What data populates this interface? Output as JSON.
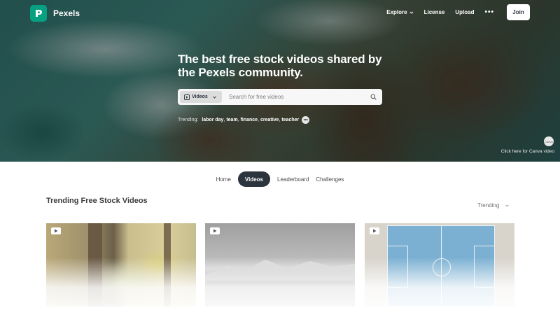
{
  "brand": {
    "name": "Pexels",
    "accent": "#07a081",
    "logo_icon": "pexels-logo-icon"
  },
  "nav": {
    "explore": "Explore",
    "license": "License",
    "upload": "Upload",
    "more": "•••",
    "join": "Join"
  },
  "hero": {
    "headline": "The best free stock videos shared by the Pexels community.",
    "search": {
      "type_label": "Videos",
      "placeholder": "Search for free videos",
      "icon": "search-icon"
    },
    "trending": {
      "label": "Trending:",
      "tags": [
        "labor day",
        "team",
        "finance",
        "creative",
        "teacher"
      ],
      "more": "•••"
    },
    "canva": {
      "badge": "Canva",
      "caption": "Click here for Canva video"
    }
  },
  "tabs": [
    {
      "label": "Home",
      "active": false
    },
    {
      "label": "Videos",
      "active": true
    },
    {
      "label": "Leaderboard",
      "active": false
    },
    {
      "label": "Challenges",
      "active": false
    }
  ],
  "section": {
    "title": "Trending Free Stock Videos",
    "sort_label": "Trending"
  },
  "videos": [
    {
      "subject": "forest-bench",
      "icon": "video-play-icon"
    },
    {
      "subject": "snowy-mountains",
      "icon": "video-play-icon"
    },
    {
      "subject": "futsal-court-aerial",
      "icon": "video-play-icon"
    }
  ]
}
